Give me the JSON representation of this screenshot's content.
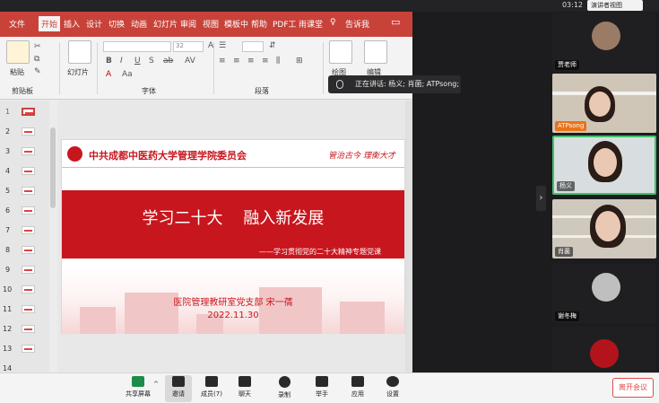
{
  "system": {
    "clock": "03:12",
    "view_button": "演讲者视图"
  },
  "ppt": {
    "tabs": [
      "文件",
      "开始",
      "插入",
      "设计",
      "切换",
      "动画",
      "幻灯片",
      "审阅",
      "视图",
      "模板中",
      "帮助",
      "PDF工",
      "雨课堂",
      "告诉我"
    ],
    "groups": {
      "clipboard": "剪贴板",
      "font": "字体",
      "paragraph": "段落"
    },
    "buttons": {
      "paste": "粘贴",
      "slides": "幻灯片",
      "draw": "绘图",
      "edit": "编辑"
    },
    "font_size": "32",
    "slide_numbers": [
      "1",
      "2",
      "3",
      "4",
      "5",
      "6",
      "7",
      "8",
      "9",
      "10",
      "11",
      "12",
      "13",
      "14"
    ]
  },
  "slide": {
    "org": "中共成都中医药大学管理学院委员会",
    "motto": "管治古今  理衡大才",
    "title": "学习二十大    融入新发展",
    "subtitle": "——学习贯彻党的二十大精神专题党课",
    "dept": "医院管理教研室党支部   宋一蒨",
    "date": "2022.11.30"
  },
  "speaking": "正在讲话: 杨义; 肖菌; ATPsong;",
  "participants": [
    {
      "name": "贾老师"
    },
    {
      "name": "ATPsong"
    },
    {
      "name": "杨义"
    },
    {
      "name": "肖菌"
    },
    {
      "name": "谢冬梅"
    }
  ],
  "toolbar": {
    "share": "共享屏幕",
    "invite": "邀请",
    "members": "成员(7)",
    "chat": "聊天",
    "record": "录制",
    "raise_hand": "举手",
    "apps": "应用",
    "settings": "设置",
    "leave": "离开会议"
  },
  "colors": {
    "ppt_accent": "#c8423a",
    "slide_red": "#c8161e",
    "leave_red": "#e04a4a"
  }
}
